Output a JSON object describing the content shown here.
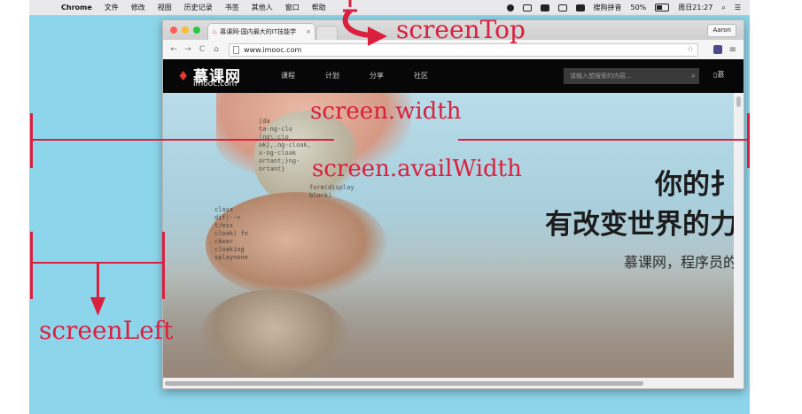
{
  "menubar": {
    "apple_glyph": "",
    "app_name": "Chrome",
    "items": [
      "文件",
      "修改",
      "视图",
      "历史记录",
      "书签",
      "其他人",
      "窗口",
      "帮助"
    ],
    "ime_label": "搜狗拼音",
    "battery": "50%",
    "clock": "周日21:27"
  },
  "browser": {
    "tab_title": "慕课网-国内最大的IT技能学",
    "tab_close": "×",
    "profile_name": "Aaron",
    "url": "www.imooc.com",
    "back": "←",
    "forward": "→",
    "reload": "C",
    "home": "⌂",
    "star": "☆",
    "menu": "≡"
  },
  "site": {
    "logo_name": "慕课网",
    "logo_domain": "imooc.com",
    "nav": [
      "课程",
      "计划",
      "分享",
      "社区"
    ],
    "search_placeholder": "请输入想搜索的内容...",
    "app_label": "慕"
  },
  "hero": {
    "line1": "你的扌",
    "line2": "有改变世界的力",
    "line3": "慕课网，程序员的",
    "code_lines": [
      [
        "[da",
        "ta-ng-clo",
        "[ng\\:clo",
        "ak],.ng-cloak,",
        "x-ng-cloak",
        "ortant;}ng-",
        "ortant}"
      ],
      [
        "class",
        "dif)-->",
        "t/ess",
        "cloak) fn",
        "ckwar",
        "cloaking",
        "splaynone"
      ],
      [
        "form(display",
        "block)"
      ]
    ]
  },
  "annotations": {
    "screen_top": "screenTop",
    "screen_width": "screen.width",
    "screen_avail_width": "screen.availWidth",
    "screen_left": "screenLeft"
  },
  "colors": {
    "desktop": "#8dd5ea",
    "annotation": "#d9203e",
    "site_nav": "#070707"
  }
}
